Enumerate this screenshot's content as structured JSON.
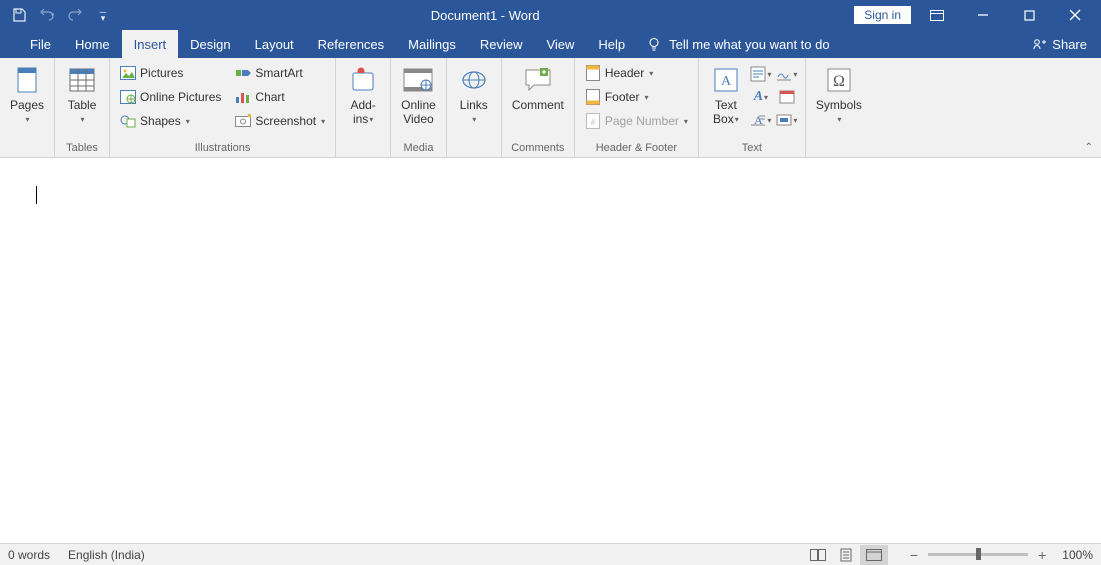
{
  "title_bar": {
    "document_title": "Document1 - Word",
    "sign_in": "Sign in"
  },
  "tabs": {
    "file": "File",
    "home": "Home",
    "insert": "Insert",
    "design": "Design",
    "layout": "Layout",
    "references": "References",
    "mailings": "Mailings",
    "review": "Review",
    "view": "View",
    "help": "Help",
    "tell_me": "Tell me what you want to do",
    "share": "Share"
  },
  "ribbon": {
    "pages": {
      "button": "Pages",
      "group_label": ""
    },
    "tables": {
      "button": "Table",
      "group_label": "Tables"
    },
    "illustrations": {
      "pictures": "Pictures",
      "online_pictures": "Online Pictures",
      "shapes": "Shapes",
      "smartart": "SmartArt",
      "chart": "Chart",
      "screenshot": "Screenshot",
      "group_label": "Illustrations"
    },
    "addins": {
      "line1": "Add-",
      "line2": "ins",
      "group_label": ""
    },
    "media": {
      "line1": "Online",
      "line2": "Video",
      "group_label": "Media"
    },
    "links": {
      "button": "Links",
      "group_label": ""
    },
    "comments": {
      "button": "Comment",
      "group_label": "Comments"
    },
    "header_footer": {
      "header": "Header",
      "footer": "Footer",
      "page_number": "Page Number",
      "group_label": "Header & Footer"
    },
    "text": {
      "textbox_line1": "Text",
      "textbox_line2": "Box",
      "group_label": "Text"
    },
    "symbols": {
      "button": "Symbols",
      "group_label": ""
    }
  },
  "status": {
    "words": "0 words",
    "language": "English (India)",
    "zoom": "100%"
  }
}
